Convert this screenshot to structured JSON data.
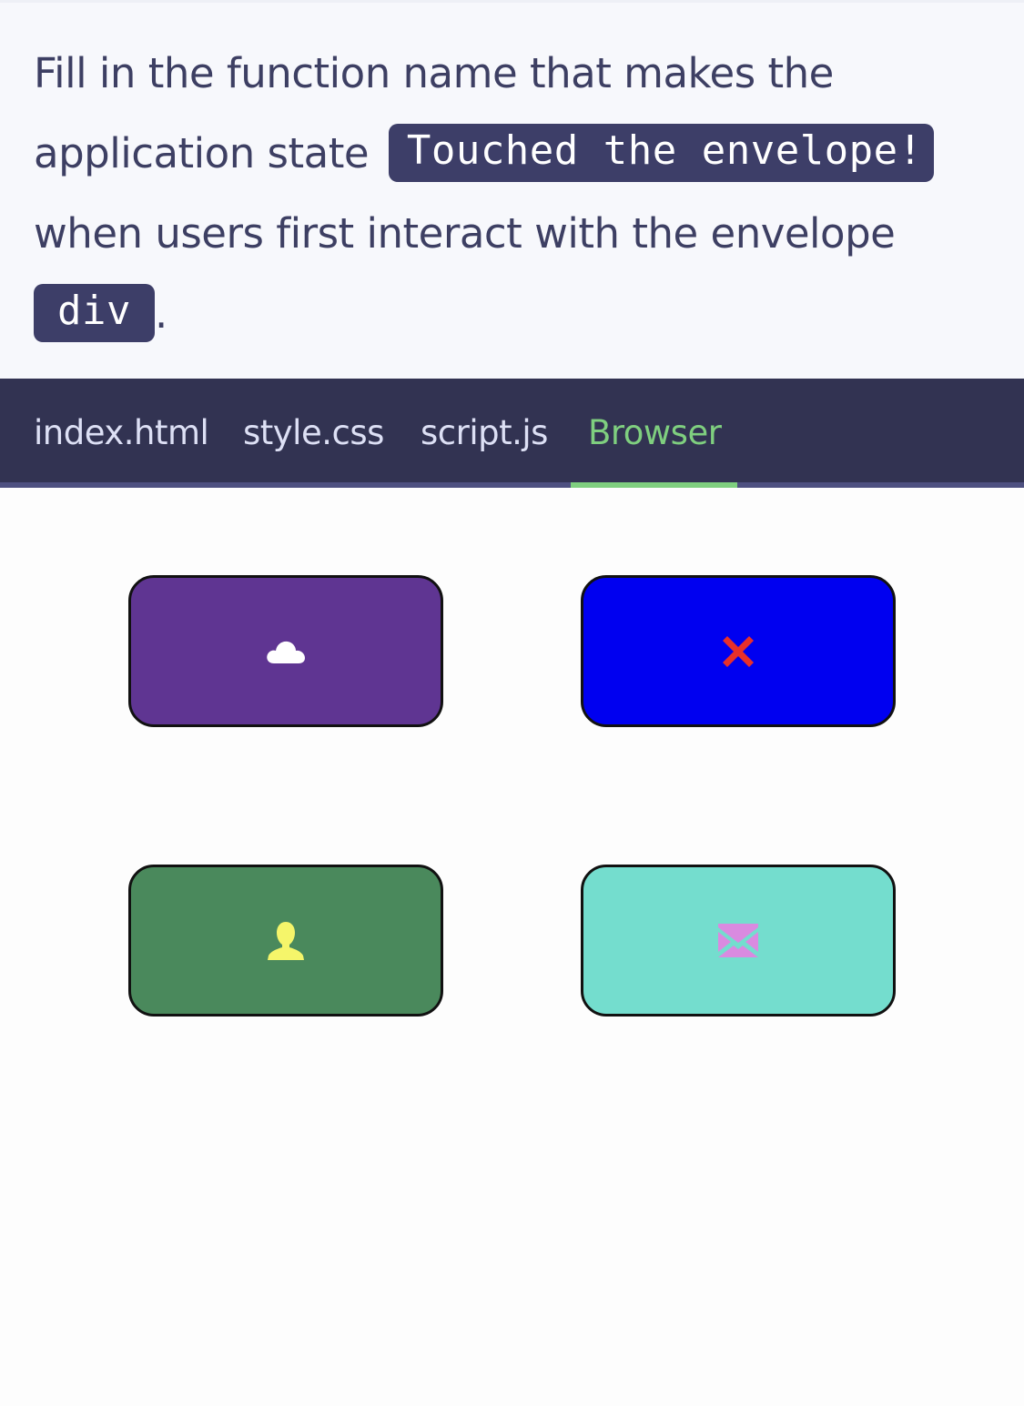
{
  "question": {
    "text_part1": "Fill in the function name that makes the application state",
    "code_state": "Touched the envelope!",
    "text_part2": "when users first interact with the envelope",
    "code_element": "div",
    "text_end": "."
  },
  "tabs": [
    {
      "label": "index.html",
      "active": false
    },
    {
      "label": "style.css",
      "active": false
    },
    {
      "label": "script.js",
      "active": false
    },
    {
      "label": "Browser",
      "active": true
    }
  ],
  "colors": {
    "tab_active": "#7fcf7f",
    "card_cloud_bg": "#5f3592",
    "card_x_bg": "#0000f0",
    "card_person_bg": "#4a895c",
    "card_envelope_bg": "#74ddce",
    "cloud_icon": "#ffffff",
    "x_icon": "#e8302a",
    "person_icon": "#f5f56a",
    "envelope_icon": "#d98ae0"
  },
  "cards": [
    {
      "icon": "cloud-icon"
    },
    {
      "icon": "x-icon"
    },
    {
      "icon": "person-icon"
    },
    {
      "icon": "envelope-icon"
    }
  ]
}
